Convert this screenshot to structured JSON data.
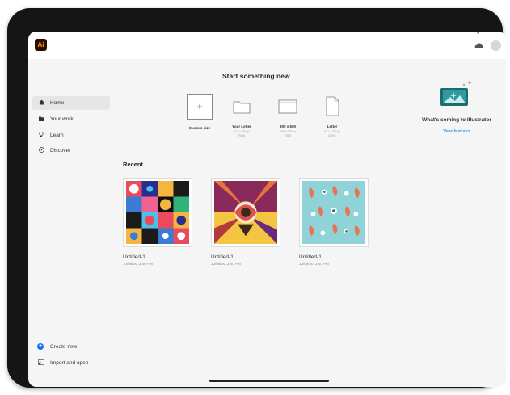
{
  "app": {
    "logo_text": "Ai"
  },
  "sidebar": {
    "items": [
      {
        "label": "Home",
        "icon": "home-icon",
        "active": true
      },
      {
        "label": "Your work",
        "icon": "folder-icon",
        "active": false
      },
      {
        "label": "Learn",
        "icon": "lightbulb-icon",
        "active": false
      },
      {
        "label": "Discover",
        "icon": "compass-icon",
        "active": false
      }
    ],
    "create_new": "Create new",
    "import_open": "Import and open"
  },
  "main": {
    "heading": "Start something new",
    "presets": [
      {
        "name": "Custom size",
        "dims": "",
        "icon": "plus-icon"
      },
      {
        "name": "Your Letter",
        "dims": "612 x 792 pt\nRGB",
        "icon": "letter-folder-icon"
      },
      {
        "name": "800 x 600",
        "dims": "800 x 600 px\nRGB",
        "icon": "screen-icon"
      },
      {
        "name": "Letter",
        "dims": "612 x 792 pt\nCMYK",
        "icon": "document-icon"
      }
    ],
    "recent_label": "Recent",
    "recent": [
      {
        "title": "Untitled-1",
        "date": "10/09/20, 2:40 PM"
      },
      {
        "title": "Untitled-1",
        "date": "10/09/20, 2:40 PM"
      },
      {
        "title": "Untitled-1",
        "date": "10/09/20, 2:40 PM"
      }
    ]
  },
  "promo": {
    "title": "What's coming to Illustrator",
    "link": "View features"
  },
  "colors": {
    "accent": "#1473e6",
    "logo_bg": "#2d0c00",
    "logo_fg": "#ff9a00"
  }
}
